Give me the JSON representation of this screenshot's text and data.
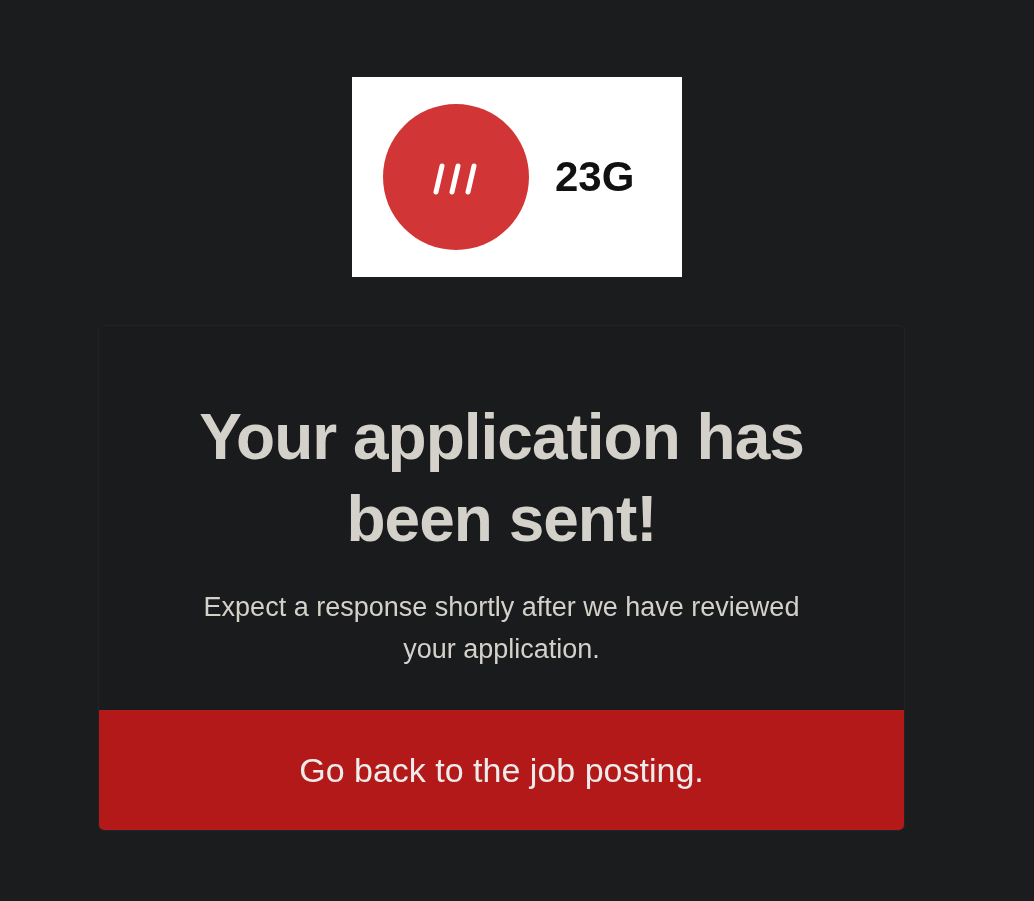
{
  "logo": {
    "text": "23G"
  },
  "card": {
    "heading": "Your application has been sent!",
    "message": "Expect a response shortly after we have reviewed your application.",
    "link": "Go back to the job posting."
  }
}
